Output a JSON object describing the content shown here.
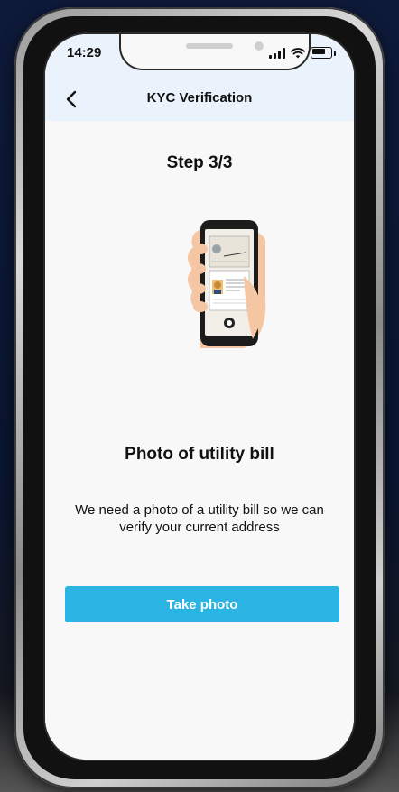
{
  "status_bar": {
    "time": "14:29",
    "icons": [
      "signal-icon",
      "wifi-icon",
      "battery-icon"
    ]
  },
  "nav": {
    "title": "KYC Verification",
    "back_icon": "chevron-left-icon"
  },
  "step": {
    "label": "Step 3/3"
  },
  "illustration": {
    "icon": "phone-scanning-document-icon"
  },
  "content": {
    "title": "Photo of utility bill",
    "description": "We need a photo of a utility bill so we can verify your current address"
  },
  "actions": {
    "take_photo_label": "Take photo"
  },
  "colors": {
    "primary": "#2bb3e3",
    "header_bg": "#eaf2fb",
    "screen_bg": "#f8f8f8",
    "text": "#111111"
  }
}
